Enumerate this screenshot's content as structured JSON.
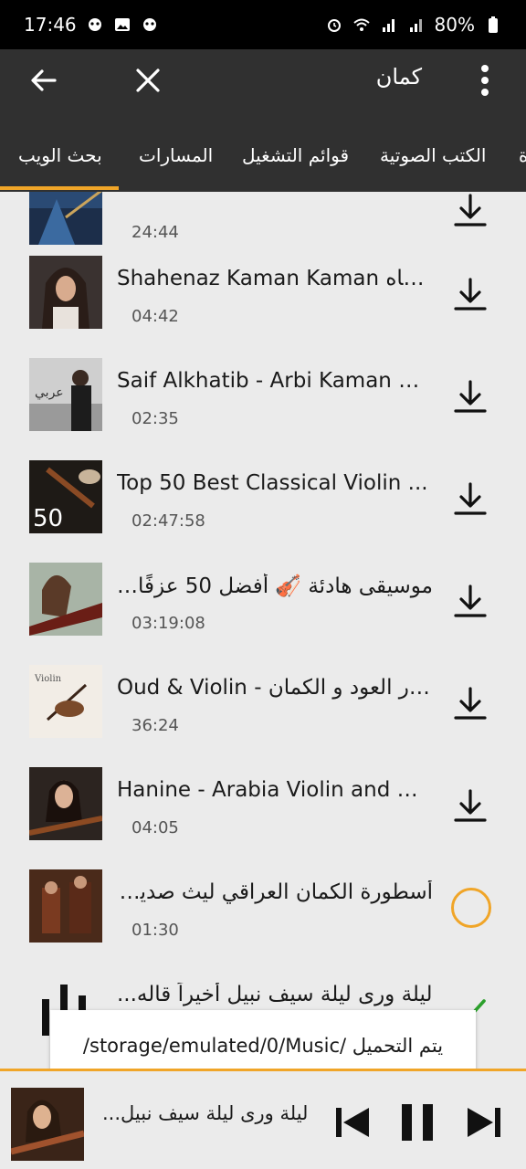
{
  "status": {
    "time": "17:46",
    "battery": "80%"
  },
  "appbar": {
    "query": "كمان"
  },
  "tabs": [
    "بحث الويب",
    "المسارات",
    "قوائم التشغيل",
    "الكتب الصوتية",
    "ة"
  ],
  "list": [
    {
      "title": "",
      "duration": "24:44",
      "action": "download"
    },
    {
      "title": "Shahenaz Kaman Kaman شاه...",
      "duration": "04:42",
      "action": "download"
    },
    {
      "title": "Saif Alkhatib - Arbi Kaman   ق...",
      "duration": "02:35",
      "action": "download"
    },
    {
      "title": "Top 50 Best Classical Violin ...",
      "duration": "02:47:58",
      "action": "download"
    },
    {
      "title": "موسيقى هادئة 🎻 أفضل 50 عزفًا م...",
      "duration": "03:19:08",
      "action": "download"
    },
    {
      "title": "Oud & Violin - حوار العود و الكمان",
      "duration": "36:24",
      "action": "download"
    },
    {
      "title": "Hanine - Arabia  Violin and D...",
      "duration": "04:05",
      "action": "download"
    },
    {
      "title": "أسطورة الكمان العراقي ليث صديق ...",
      "duration": "01:30",
      "action": "loading"
    },
    {
      "title": "ليلة ورى ليلة  سيف نبيل   أخيراً قاله...",
      "duration": "",
      "action": "done"
    }
  ],
  "toast": {
    "text": "يتم التحميل /storage/emulated/0/Music/"
  },
  "player": {
    "title": "ليلة ورى ليلة  سيف نبيل..."
  },
  "colors": {
    "accent": "#f0a528",
    "appbar": "#303030",
    "background": "#ebebeb"
  }
}
